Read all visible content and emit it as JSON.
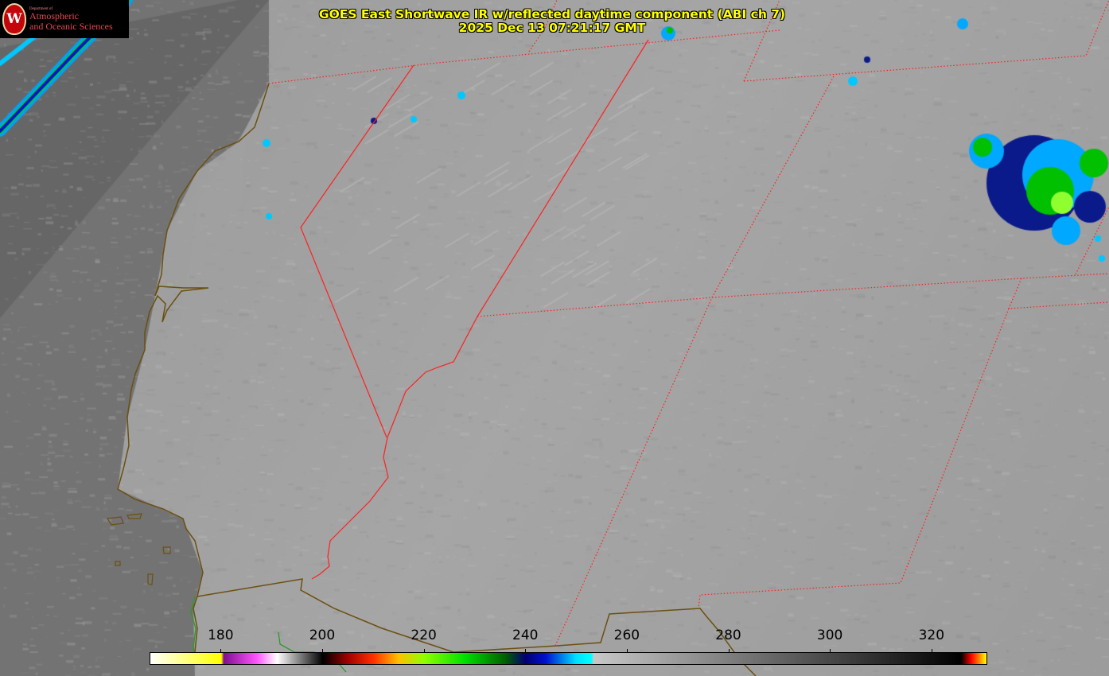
{
  "title": {
    "line1": "GOES East Shortwave IR w/reflected daytime component (ABI ch 7)",
    "line2": "2025 Dec 13 07:21:17 GMT"
  },
  "logo": {
    "dept": "Department of",
    "line1": "Atmospheric",
    "line2": "and Oceanic Sciences",
    "seal_letter": "W"
  },
  "colorbar": {
    "range": [
      166,
      331
    ],
    "ticks": [
      "180",
      "200",
      "220",
      "240",
      "260",
      "280",
      "300",
      "320"
    ],
    "tick_values": [
      180,
      200,
      220,
      240,
      260,
      280,
      300,
      320
    ],
    "stops": [
      {
        "v": 166,
        "c": "#ffffff"
      },
      {
        "v": 180,
        "c": "#ffff00"
      },
      {
        "v": 180.5,
        "c": "#7f0f8f"
      },
      {
        "v": 187,
        "c": "#ff55ff"
      },
      {
        "v": 191,
        "c": "#ffffff"
      },
      {
        "v": 200,
        "c": "#000000"
      },
      {
        "v": 205,
        "c": "#a00000"
      },
      {
        "v": 210,
        "c": "#ff3000"
      },
      {
        "v": 215,
        "c": "#ffc000"
      },
      {
        "v": 220,
        "c": "#90ff00"
      },
      {
        "v": 228,
        "c": "#00e000"
      },
      {
        "v": 236,
        "c": "#006000"
      },
      {
        "v": 240,
        "c": "#000070"
      },
      {
        "v": 244,
        "c": "#0010d0"
      },
      {
        "v": 250,
        "c": "#00e0ff"
      },
      {
        "v": 253,
        "c": "#00ffff"
      },
      {
        "v": 253.5,
        "c": "#c8c8c8"
      },
      {
        "v": 326,
        "c": "#000000"
      },
      {
        "v": 328,
        "c": "#ff0000"
      },
      {
        "v": 331,
        "c": "#ffff00"
      }
    ]
  },
  "colors": {
    "state_border": "#ff2020",
    "coastline": "#6b5010",
    "title_text": "#ffff00",
    "ocean": "#737373",
    "land": "#a3a3a3"
  }
}
